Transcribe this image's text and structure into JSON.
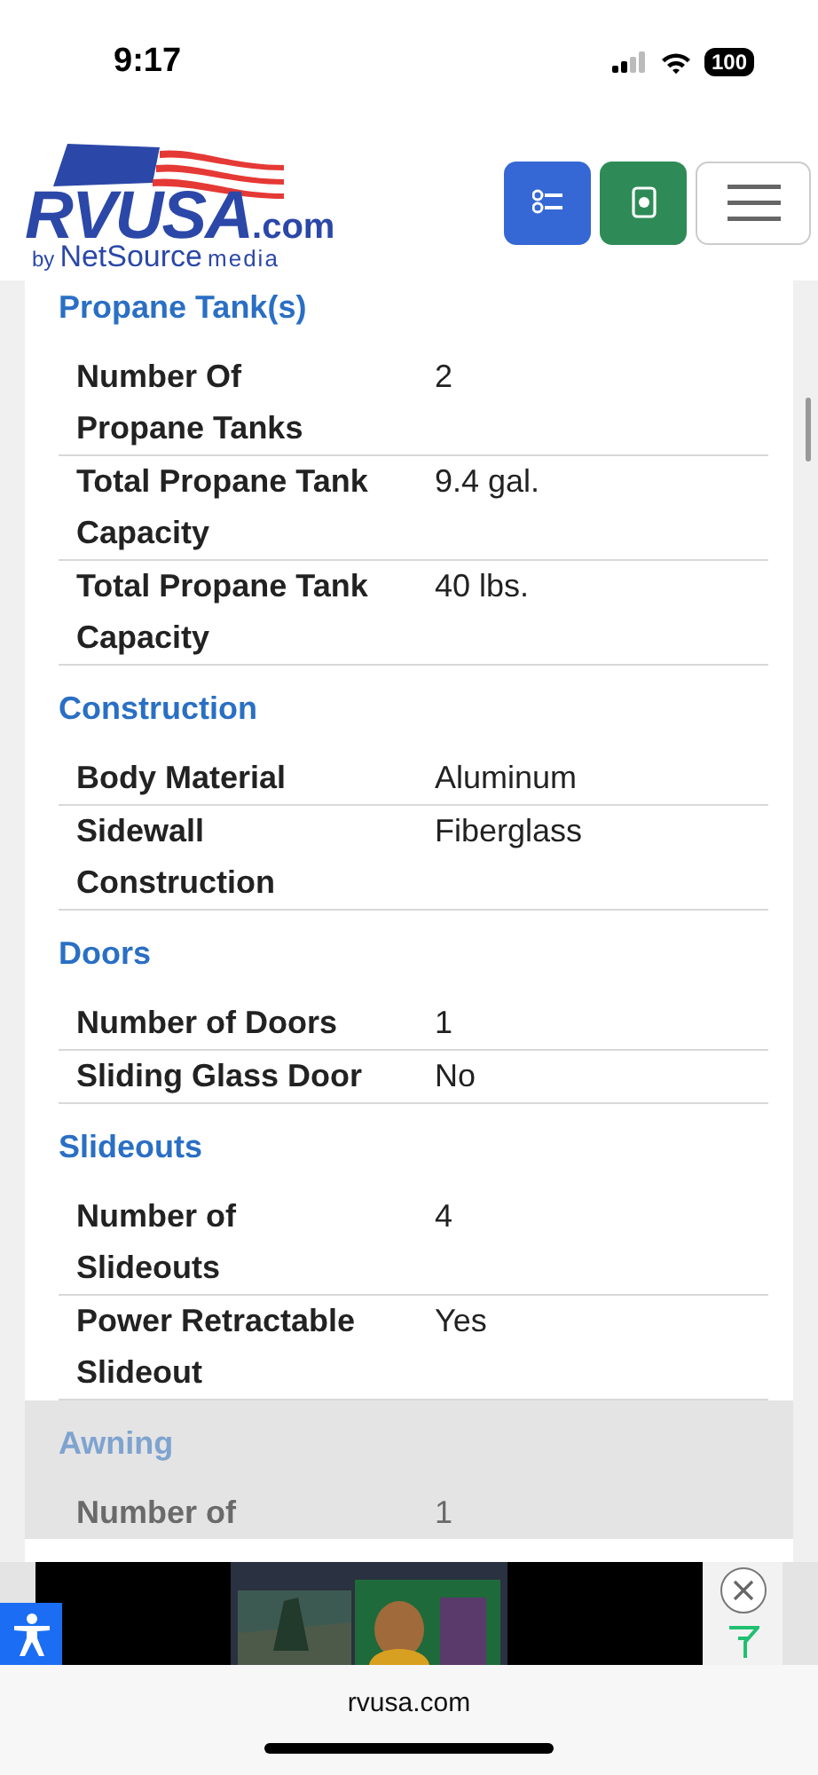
{
  "status_bar": {
    "time": "9:17",
    "battery": "100"
  },
  "header": {
    "logo_main": "RVUSA",
    "logo_suffix": ".com",
    "logo_by": "by",
    "logo_brand": "NetSource",
    "logo_media": "media"
  },
  "sections": [
    {
      "title": "Propane Tank(s)",
      "dimmed": false,
      "rows": [
        {
          "label": "Number Of Propane Tanks",
          "value": "2"
        },
        {
          "label": "Total Propane Tank Capacity",
          "value": "9.4 gal."
        },
        {
          "label": "Total Propane Tank Capacity",
          "value": "40 lbs."
        }
      ]
    },
    {
      "title": "Construction",
      "dimmed": false,
      "rows": [
        {
          "label": "Body Material",
          "value": "Aluminum"
        },
        {
          "label": "Sidewall Construction",
          "value": "Fiberglass"
        }
      ]
    },
    {
      "title": "Doors",
      "dimmed": false,
      "rows": [
        {
          "label": "Number of Doors",
          "value": "1"
        },
        {
          "label": "Sliding Glass Door",
          "value": "No"
        }
      ]
    },
    {
      "title": "Slideouts",
      "dimmed": false,
      "rows": [
        {
          "label": "Number of Slideouts",
          "value": "4"
        },
        {
          "label": "Power Retractable Slideout",
          "value": "Yes"
        }
      ]
    },
    {
      "title": "Awning",
      "dimmed": true,
      "rows": [
        {
          "label": "Number of",
          "value": "1"
        }
      ]
    }
  ],
  "browser": {
    "url": "rvusa.com"
  }
}
